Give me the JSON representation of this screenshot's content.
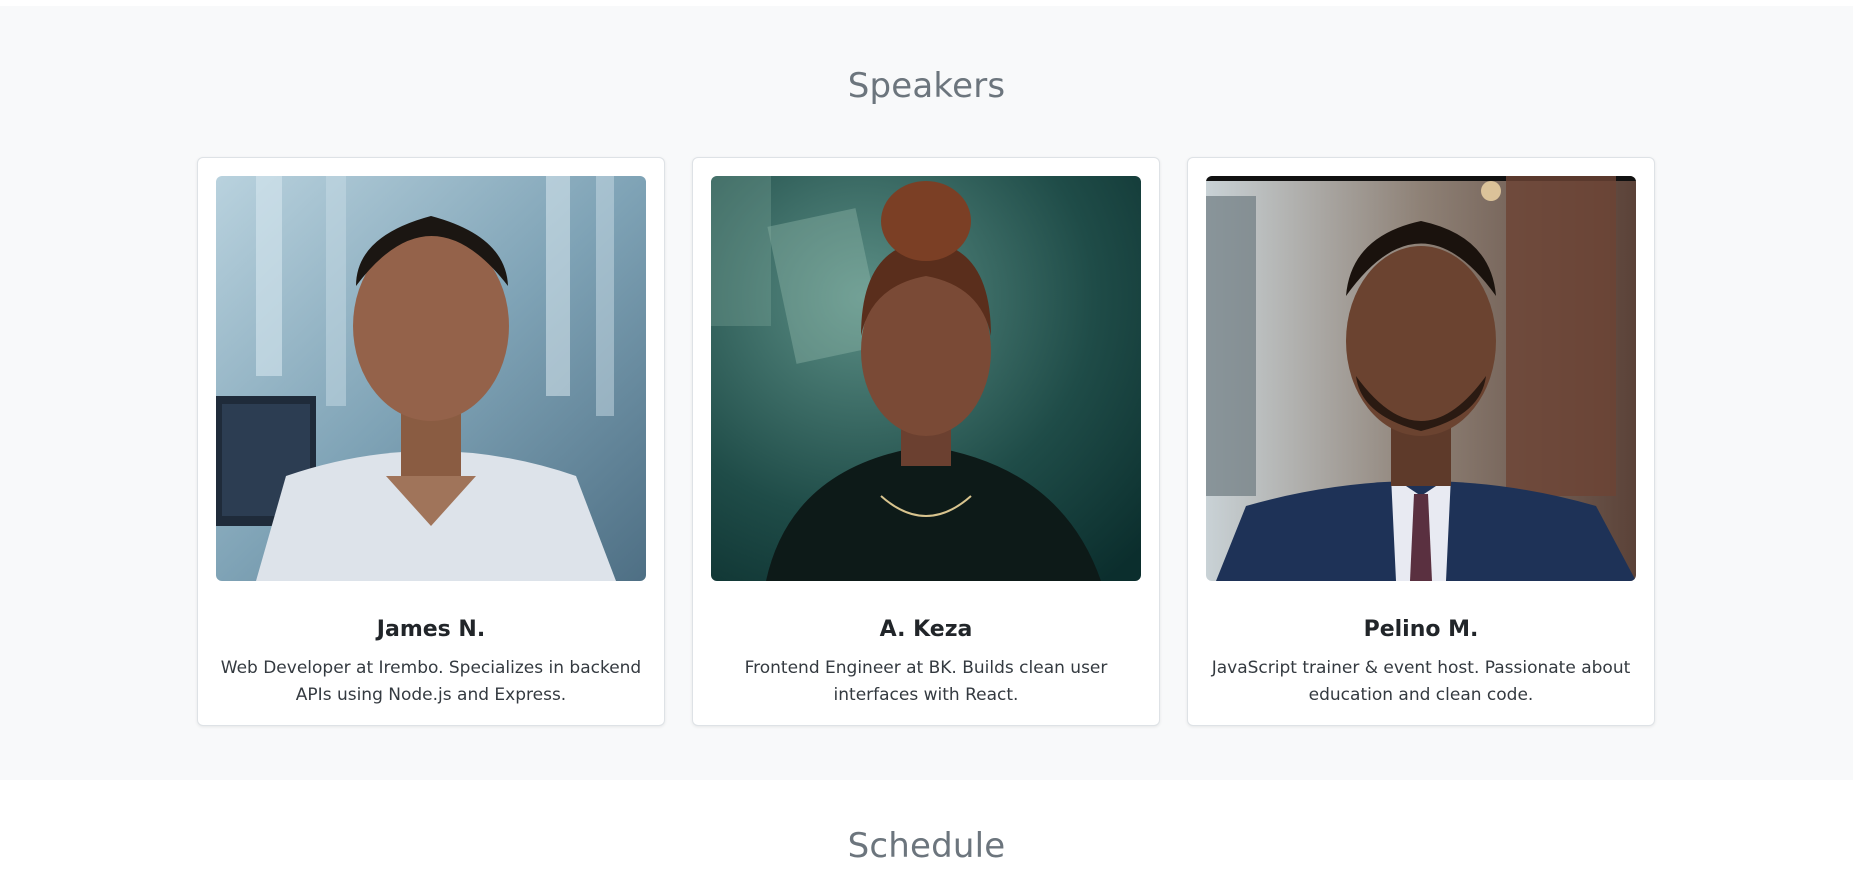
{
  "speakers": {
    "title": "Speakers",
    "items": [
      {
        "name": "James N.",
        "bio": "Web Developer at Irembo. Specializes in backend APIs using Node.js and Express.",
        "photo_icon": "speaker-photo"
      },
      {
        "name": "A. Keza",
        "bio": "Frontend Engineer at BK. Builds clean user interfaces with React.",
        "photo_icon": "speaker-photo"
      },
      {
        "name": "Pelino M.",
        "bio": "JavaScript trainer & event host. Passionate about education and clean code.",
        "photo_icon": "speaker-photo"
      }
    ]
  },
  "schedule": {
    "title": "Schedule"
  },
  "colors": {
    "section_bg": "#f8f9fa",
    "title": "#6c757d",
    "card_border": "#dee2e6"
  }
}
